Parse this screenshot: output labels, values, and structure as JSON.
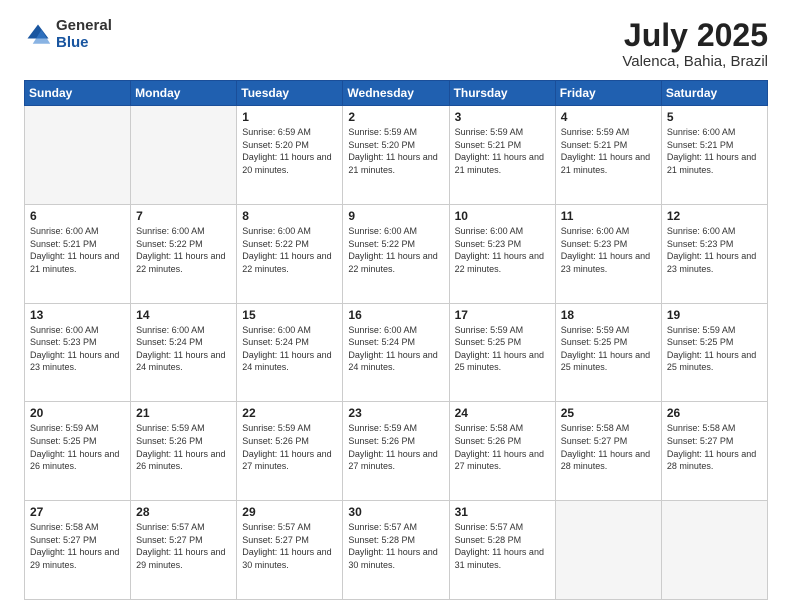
{
  "header": {
    "logo_general": "General",
    "logo_blue": "Blue",
    "title": "July 2025",
    "location": "Valenca, Bahia, Brazil"
  },
  "weekdays": [
    "Sunday",
    "Monday",
    "Tuesday",
    "Wednesday",
    "Thursday",
    "Friday",
    "Saturday"
  ],
  "weeks": [
    [
      {
        "day": "",
        "empty": true
      },
      {
        "day": "",
        "empty": true
      },
      {
        "day": "1",
        "sunrise": "6:59 AM",
        "sunset": "5:20 PM",
        "daylight": "11 hours and 20 minutes."
      },
      {
        "day": "2",
        "sunrise": "5:59 AM",
        "sunset": "5:20 PM",
        "daylight": "11 hours and 21 minutes."
      },
      {
        "day": "3",
        "sunrise": "5:59 AM",
        "sunset": "5:21 PM",
        "daylight": "11 hours and 21 minutes."
      },
      {
        "day": "4",
        "sunrise": "5:59 AM",
        "sunset": "5:21 PM",
        "daylight": "11 hours and 21 minutes."
      },
      {
        "day": "5",
        "sunrise": "6:00 AM",
        "sunset": "5:21 PM",
        "daylight": "11 hours and 21 minutes."
      }
    ],
    [
      {
        "day": "6",
        "sunrise": "6:00 AM",
        "sunset": "5:21 PM",
        "daylight": "11 hours and 21 minutes."
      },
      {
        "day": "7",
        "sunrise": "6:00 AM",
        "sunset": "5:22 PM",
        "daylight": "11 hours and 22 minutes."
      },
      {
        "day": "8",
        "sunrise": "6:00 AM",
        "sunset": "5:22 PM",
        "daylight": "11 hours and 22 minutes."
      },
      {
        "day": "9",
        "sunrise": "6:00 AM",
        "sunset": "5:22 PM",
        "daylight": "11 hours and 22 minutes."
      },
      {
        "day": "10",
        "sunrise": "6:00 AM",
        "sunset": "5:23 PM",
        "daylight": "11 hours and 22 minutes."
      },
      {
        "day": "11",
        "sunrise": "6:00 AM",
        "sunset": "5:23 PM",
        "daylight": "11 hours and 23 minutes."
      },
      {
        "day": "12",
        "sunrise": "6:00 AM",
        "sunset": "5:23 PM",
        "daylight": "11 hours and 23 minutes."
      }
    ],
    [
      {
        "day": "13",
        "sunrise": "6:00 AM",
        "sunset": "5:23 PM",
        "daylight": "11 hours and 23 minutes."
      },
      {
        "day": "14",
        "sunrise": "6:00 AM",
        "sunset": "5:24 PM",
        "daylight": "11 hours and 24 minutes."
      },
      {
        "day": "15",
        "sunrise": "6:00 AM",
        "sunset": "5:24 PM",
        "daylight": "11 hours and 24 minutes."
      },
      {
        "day": "16",
        "sunrise": "6:00 AM",
        "sunset": "5:24 PM",
        "daylight": "11 hours and 24 minutes."
      },
      {
        "day": "17",
        "sunrise": "5:59 AM",
        "sunset": "5:25 PM",
        "daylight": "11 hours and 25 minutes."
      },
      {
        "day": "18",
        "sunrise": "5:59 AM",
        "sunset": "5:25 PM",
        "daylight": "11 hours and 25 minutes."
      },
      {
        "day": "19",
        "sunrise": "5:59 AM",
        "sunset": "5:25 PM",
        "daylight": "11 hours and 25 minutes."
      }
    ],
    [
      {
        "day": "20",
        "sunrise": "5:59 AM",
        "sunset": "5:25 PM",
        "daylight": "11 hours and 26 minutes."
      },
      {
        "day": "21",
        "sunrise": "5:59 AM",
        "sunset": "5:26 PM",
        "daylight": "11 hours and 26 minutes."
      },
      {
        "day": "22",
        "sunrise": "5:59 AM",
        "sunset": "5:26 PM",
        "daylight": "11 hours and 27 minutes."
      },
      {
        "day": "23",
        "sunrise": "5:59 AM",
        "sunset": "5:26 PM",
        "daylight": "11 hours and 27 minutes."
      },
      {
        "day": "24",
        "sunrise": "5:58 AM",
        "sunset": "5:26 PM",
        "daylight": "11 hours and 27 minutes."
      },
      {
        "day": "25",
        "sunrise": "5:58 AM",
        "sunset": "5:27 PM",
        "daylight": "11 hours and 28 minutes."
      },
      {
        "day": "26",
        "sunrise": "5:58 AM",
        "sunset": "5:27 PM",
        "daylight": "11 hours and 28 minutes."
      }
    ],
    [
      {
        "day": "27",
        "sunrise": "5:58 AM",
        "sunset": "5:27 PM",
        "daylight": "11 hours and 29 minutes."
      },
      {
        "day": "28",
        "sunrise": "5:57 AM",
        "sunset": "5:27 PM",
        "daylight": "11 hours and 29 minutes."
      },
      {
        "day": "29",
        "sunrise": "5:57 AM",
        "sunset": "5:27 PM",
        "daylight": "11 hours and 30 minutes."
      },
      {
        "day": "30",
        "sunrise": "5:57 AM",
        "sunset": "5:28 PM",
        "daylight": "11 hours and 30 minutes."
      },
      {
        "day": "31",
        "sunrise": "5:57 AM",
        "sunset": "5:28 PM",
        "daylight": "11 hours and 31 minutes."
      },
      {
        "day": "",
        "empty": true
      },
      {
        "day": "",
        "empty": true
      }
    ]
  ]
}
